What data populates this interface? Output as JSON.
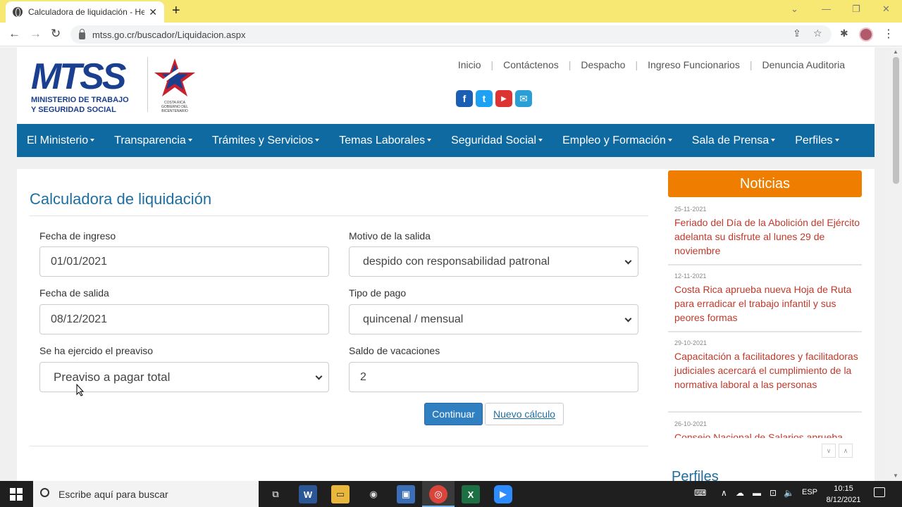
{
  "browser": {
    "tab_title": "Calculadora de liquidación - Herr",
    "tab_close": "✕",
    "new_tab": "+",
    "url": "mtss.go.cr/buscador/Liquidacion.aspx",
    "window_controls": [
      "⌄",
      "—",
      "❐",
      "✕"
    ]
  },
  "header": {
    "logo_text": "MTSS",
    "logo_subtitle_1": "MINISTERIO DE TRABAJO",
    "logo_subtitle_2": "Y SEGURIDAD SOCIAL",
    "cr_logo_text_1": "COSTA RICA",
    "cr_logo_text_2": "GOBIERNO DEL BICENTENARIO",
    "top_links": [
      "Inicio",
      "Contáctenos",
      "Despacho",
      "Ingreso Funcionarios",
      "Denuncia Auditoria"
    ],
    "socials": [
      {
        "name": "facebook-icon",
        "glyph": "f",
        "color": "#1a5fb4"
      },
      {
        "name": "twitter-icon",
        "glyph": "t",
        "color": "#1da1f2"
      },
      {
        "name": "youtube-icon",
        "glyph": "▶",
        "color": "#d33"
      },
      {
        "name": "email-icon",
        "glyph": "✉",
        "color": "#2a9fd6"
      }
    ]
  },
  "nav": {
    "items": [
      "El Ministerio",
      "Transparencia",
      "Trámites y Servicios",
      "Temas Laborales",
      "Seguridad Social",
      "Empleo y Formación",
      "Sala de Prensa",
      "Perfiles"
    ]
  },
  "form": {
    "title": "Calculadora de liquidación",
    "fecha_ingreso_label": "Fecha de ingreso",
    "fecha_ingreso_value": "01/01/2021",
    "motivo_label": "Motivo de la salida",
    "motivo_value": "despido con responsabilidad patronal",
    "fecha_salida_label": "Fecha de salida",
    "fecha_salida_value": "08/12/2021",
    "tipo_pago_label": "Tipo de pago",
    "tipo_pago_value": "quincenal / mensual",
    "preaviso_label": "Se ha ejercido el preaviso",
    "preaviso_value": "Preaviso a pagar total",
    "vacaciones_label": "Saldo de vacaciones",
    "vacaciones_value": "2",
    "continuar_label": "Continuar",
    "nuevo_label": "Nuevo cálculo"
  },
  "news": {
    "header": "Noticias",
    "items": [
      {
        "date": "25-11-2021",
        "title": "Feriado del Día de la Abolición del Ejército adelanta su disfrute al lunes 29 de noviembre"
      },
      {
        "date": "12-11-2021",
        "title": "Costa Rica aprueba nueva Hoja de Ruta para erradicar el trabajo infantil y sus peores formas"
      },
      {
        "date": "29-10-2021",
        "title": "Capacitación a facilitadores y facilitadoras judiciales acercará el cumplimiento de la normativa laboral a las personas"
      },
      {
        "date": "26-10-2021",
        "title": "Consejo Nacional de Salarios aprueba"
      }
    ],
    "scroll_down": "∨",
    "scroll_up": "∧",
    "perfiles_heading": "Perfiles"
  },
  "taskbar": {
    "search_placeholder": "Escribe aquí para buscar",
    "language": "ESP",
    "time": "10:15",
    "date": "8/12/2021"
  }
}
